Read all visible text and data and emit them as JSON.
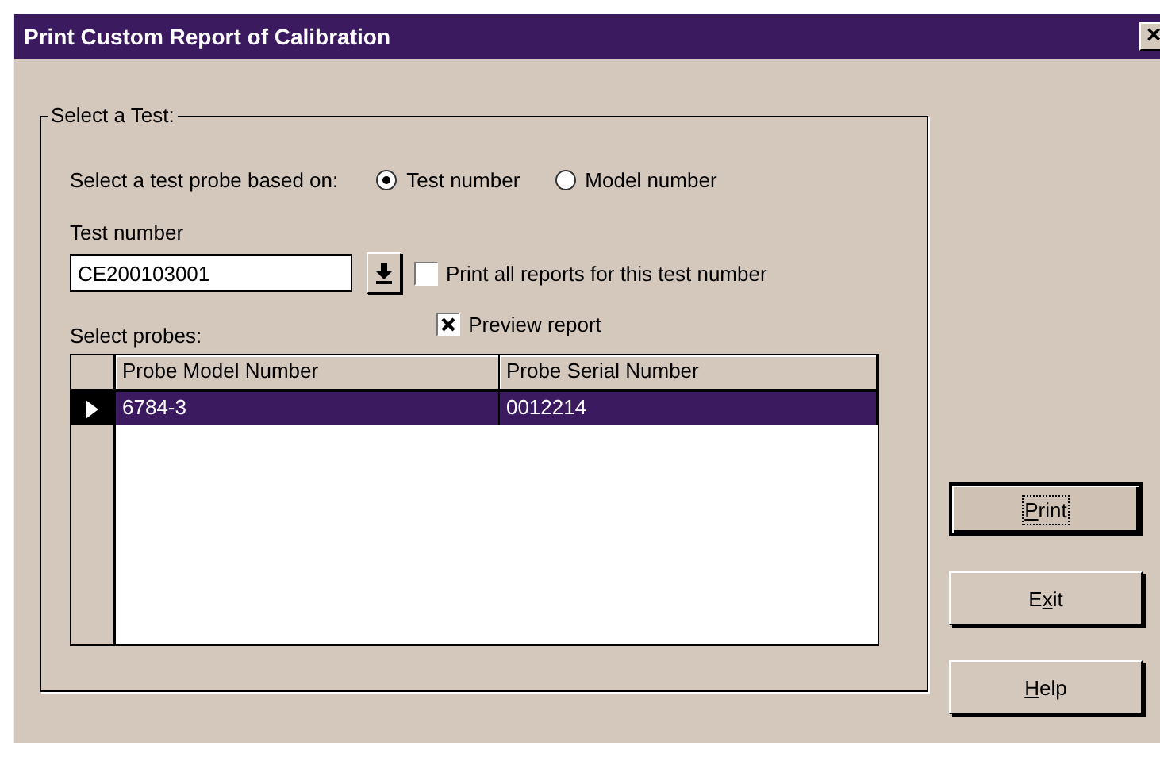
{
  "window": {
    "title": "Print Custom Report of Calibration",
    "close": "×"
  },
  "group": {
    "title": "Select a Test:",
    "basis_label": "Select a test probe based on:",
    "basis_options": [
      {
        "label": "Test number",
        "selected": true
      },
      {
        "label": "Model number",
        "selected": false
      }
    ],
    "test_number_label": "Test number",
    "test_number_value": "CE200103001",
    "checkboxes": [
      {
        "label": "Print all reports for this test number",
        "checked": false
      },
      {
        "label": "Preview report",
        "checked": true
      }
    ],
    "probes_label": "Select probes:",
    "table": {
      "columns": [
        "Probe Model Number",
        "Probe Serial Number"
      ],
      "rows": [
        {
          "cells": [
            "6784-3",
            "0012214"
          ],
          "selected": true
        }
      ]
    }
  },
  "buttons": [
    {
      "key": "P",
      "after": "rint",
      "focused": true
    },
    {
      "before": "E",
      "key": "x",
      "after": "it",
      "focused": false
    },
    {
      "key": "H",
      "after": "elp",
      "focused": false
    }
  ]
}
